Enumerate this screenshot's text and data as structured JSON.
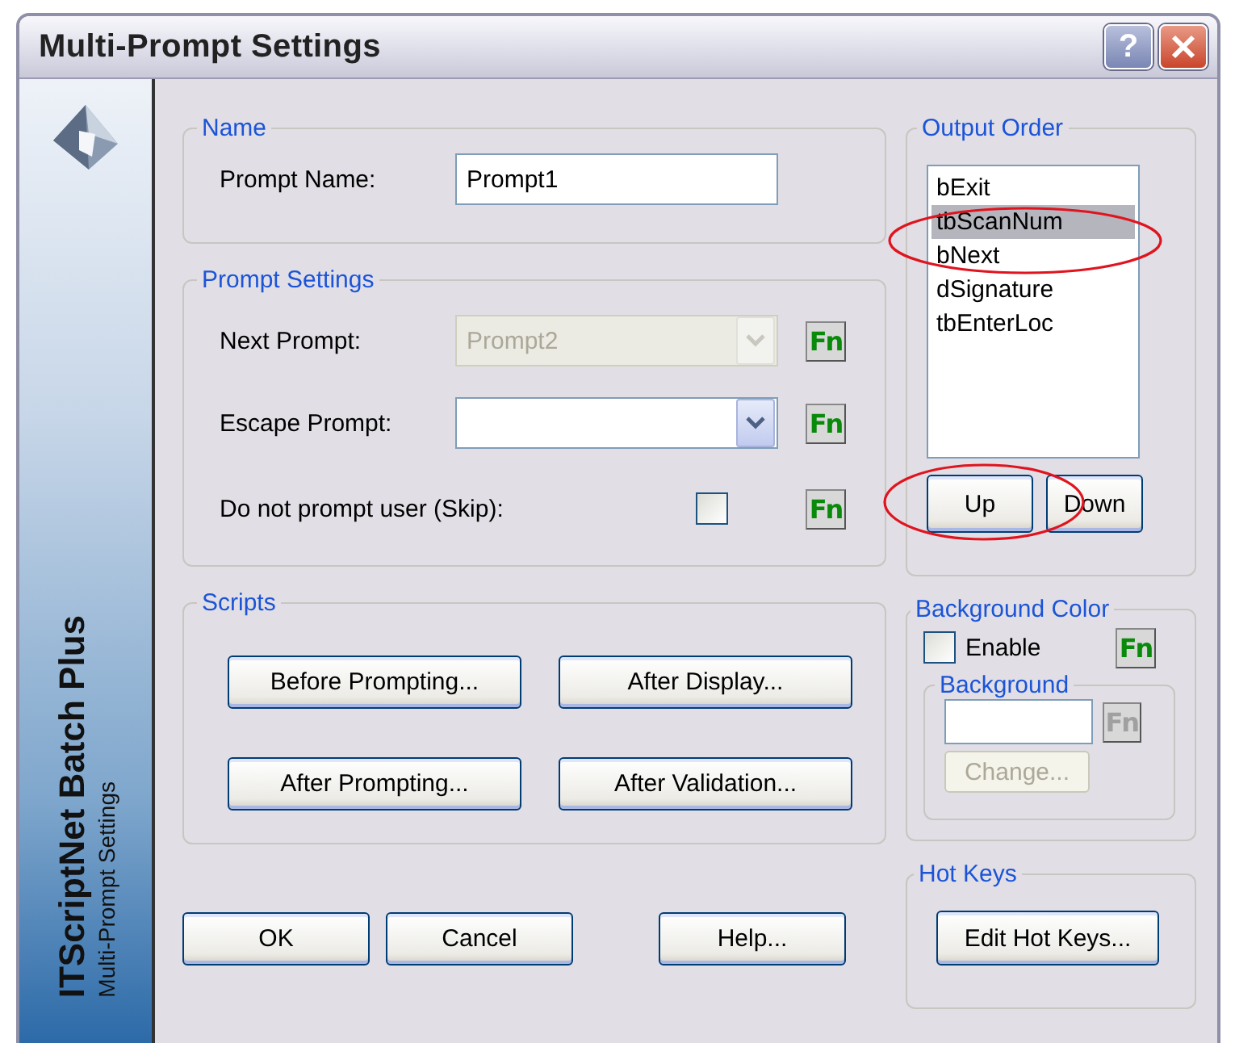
{
  "window": {
    "title": "Multi-Prompt Settings",
    "help_button": "?"
  },
  "sidebar": {
    "product": "ITScriptNet Batch Plus",
    "subtitle": "Multi-Prompt Settings"
  },
  "name_group": {
    "title": "Name",
    "label": "Prompt Name:",
    "value": "Prompt1"
  },
  "prompt_settings": {
    "title": "Prompt Settings",
    "rows": [
      {
        "kind": "dropdown",
        "label": "Next Prompt:",
        "value": "Prompt2",
        "disabled": true,
        "fn": "Fn"
      },
      {
        "kind": "dropdown",
        "label": "Escape Prompt:",
        "disabled": false,
        "fn": "Fn"
      },
      {
        "kind": "checkbox",
        "label": "Do not prompt user (Skip):",
        "checked": false,
        "fn": "Fn"
      }
    ]
  },
  "scripts": {
    "title": "Scripts",
    "buttons": [
      "Before Prompting...",
      "After Display...",
      "After Prompting...",
      "After Validation..."
    ]
  },
  "buttons": [
    "OK",
    "Cancel",
    "Help..."
  ],
  "output_order": {
    "title": "Output Order",
    "items": [
      {
        "label": "bExit",
        "selected": false
      },
      {
        "label": "tbScanNum",
        "selected": true
      },
      {
        "label": "bNext",
        "selected": false
      },
      {
        "label": "dSignature",
        "selected": false
      },
      {
        "label": "tbEnterLoc",
        "selected": false
      }
    ],
    "buttons": [
      "Up",
      "Down"
    ]
  },
  "background_color": {
    "title": "Background Color",
    "enable": {
      "label": "Enable",
      "checked": false
    },
    "fn": "Fn",
    "background": {
      "title": "Background",
      "fn": "Fn",
      "disabled": true,
      "change": "Change..."
    }
  },
  "hot_keys": {
    "title": "Hot Keys",
    "button": "Edit Hot Keys..."
  }
}
